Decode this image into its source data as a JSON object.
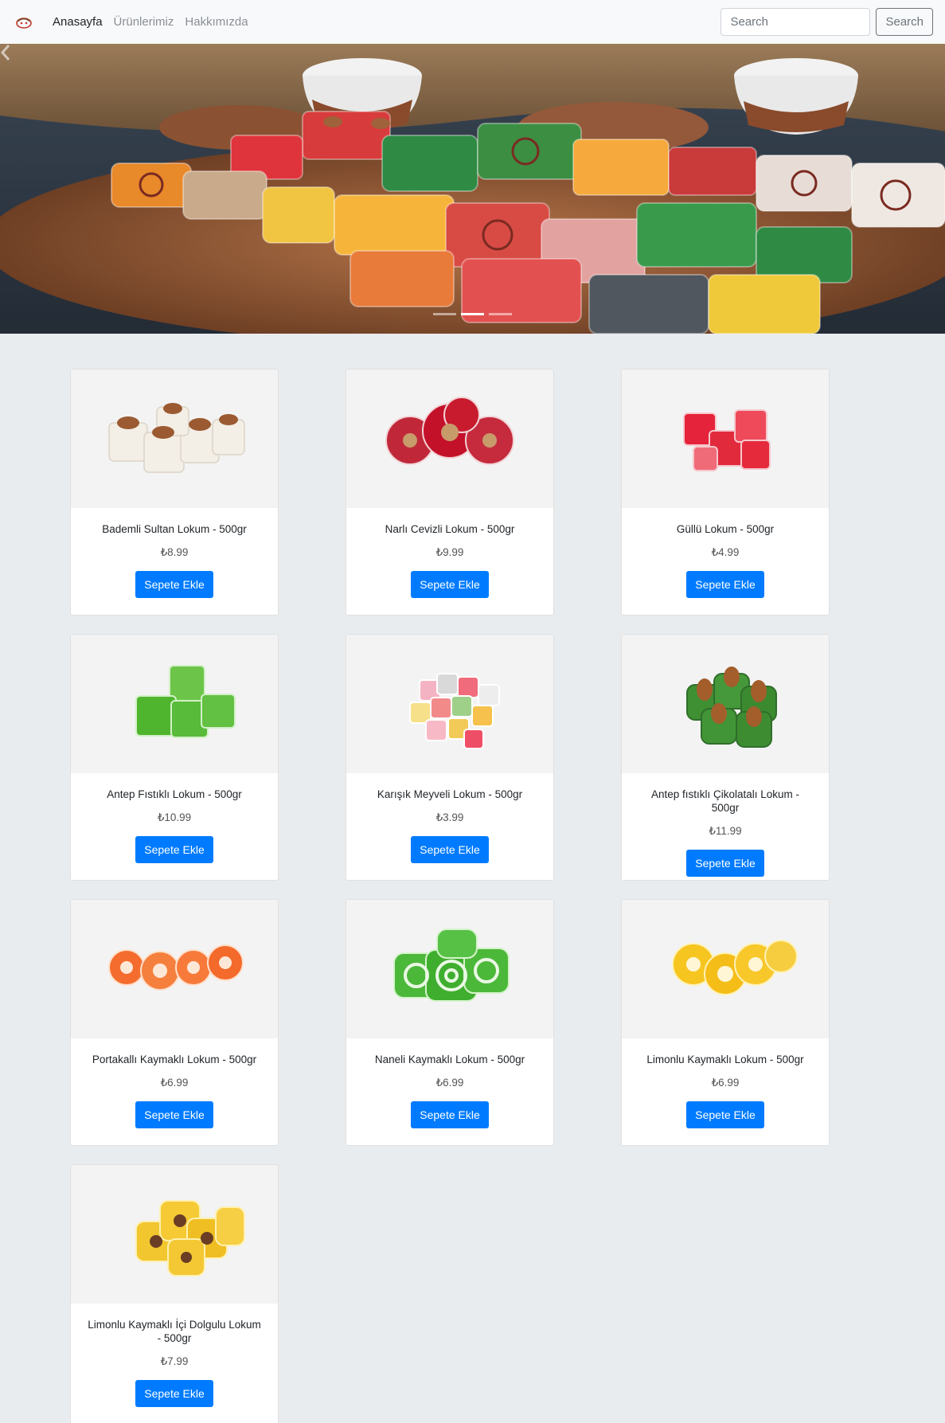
{
  "navbar": {
    "brand_icon": "lokum-logo-icon",
    "links": [
      {
        "label": "Anasayfa",
        "active": true
      },
      {
        "label": "Ürünlerimiz",
        "active": false
      },
      {
        "label": "Hakkımızda",
        "active": false
      }
    ],
    "search": {
      "placeholder": "Search",
      "value": ""
    },
    "search_button": "Search"
  },
  "carousel": {
    "prev_icon": "chevron-left-icon",
    "slide_count": 3,
    "active_slide": 2
  },
  "colors": {
    "primary": "#007bff",
    "page_background": "#e9ecef",
    "navbar_background": "#f8f9fa"
  },
  "products": [
    {
      "name": "Bademli Sultan Lokum - 500gr",
      "price": "₺8.99",
      "button": "Sepete Ekle",
      "icon": "almond-lokum-icon"
    },
    {
      "name": "Narlı Cevizli Lokum - 500gr",
      "price": "₺9.99",
      "button": "Sepete Ekle",
      "icon": "pomegranate-walnut-lokum-icon"
    },
    {
      "name": "Güllü Lokum - 500gr",
      "price": "₺4.99",
      "button": "Sepete Ekle",
      "icon": "rose-lokum-icon"
    },
    {
      "name": "Antep Fıstıklı Lokum - 500gr",
      "price": "₺10.99",
      "button": "Sepete Ekle",
      "icon": "pistachio-lokum-icon"
    },
    {
      "name": "Karışık Meyveli Lokum - 500gr",
      "price": "₺3.99",
      "button": "Sepete Ekle",
      "icon": "mixed-fruit-lokum-icon"
    },
    {
      "name": "Antep fıstıklı Çikolatalı Lokum - 500gr",
      "price": "₺11.99",
      "button": "Sepete Ekle",
      "icon": "pistachio-chocolate-lokum-icon"
    },
    {
      "name": "Portakallı Kaymaklı Lokum - 500gr",
      "price": "₺6.99",
      "button": "Sepete Ekle",
      "icon": "orange-cream-lokum-icon"
    },
    {
      "name": "Naneli Kaymaklı Lokum - 500gr",
      "price": "₺6.99",
      "button": "Sepete Ekle",
      "icon": "mint-cream-lokum-icon"
    },
    {
      "name": "Limonlu Kaymaklı Lokum - 500gr",
      "price": "₺6.99",
      "button": "Sepete Ekle",
      "icon": "lemon-cream-lokum-icon"
    },
    {
      "name": "Limonlu Kaymaklı İçi Dolgulu Lokum - 500gr",
      "price": "₺7.99",
      "button": "Sepete Ekle",
      "icon": "filled-lemon-lokum-icon"
    }
  ]
}
